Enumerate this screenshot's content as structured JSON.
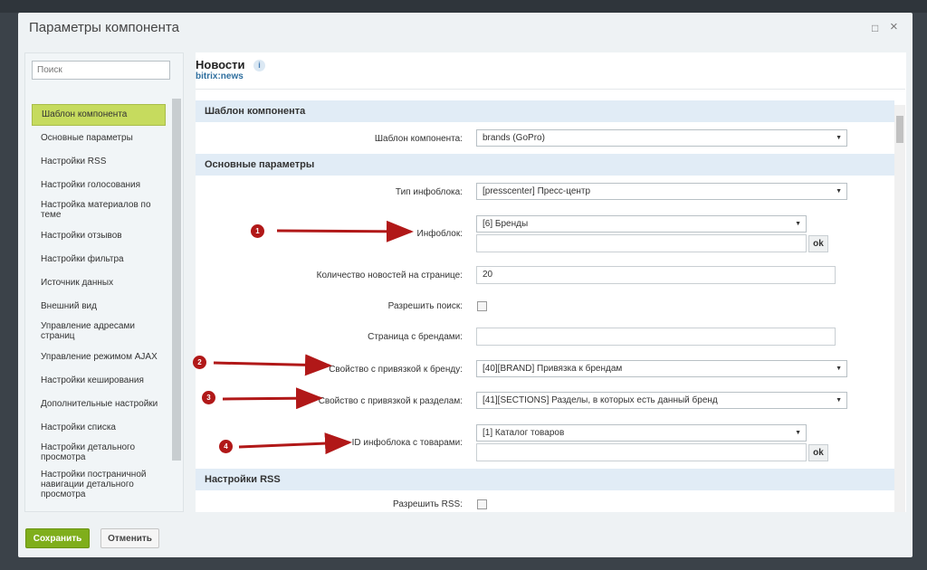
{
  "dialog": {
    "title": "Параметры компонента",
    "collapse": "□",
    "close": "×"
  },
  "sidebar": {
    "search_placeholder": "Поиск",
    "items": [
      "Шаблон компонента",
      "Основные параметры",
      "Настройки RSS",
      "Настройки голосования",
      "Настройка материалов по теме",
      "Настройки отзывов",
      "Настройки фильтра",
      "Источник данных",
      "Внешний вид",
      "Управление адресами страниц",
      "Управление режимом AJAX",
      "Настройки кеширования",
      "Дополнительные настройки",
      "Настройки списка",
      "Настройки детального просмотра",
      "Настройки постраничной навигации детального просмотра"
    ]
  },
  "component": {
    "name": "Новости",
    "code": "bitrix:news",
    "info_icon": "i"
  },
  "sections": {
    "template": "Шаблон компонента",
    "basic": "Основные параметры",
    "rss": "Настройки RSS"
  },
  "fields": {
    "template": {
      "label": "Шаблон компонента:",
      "value": "brands (GoPro)"
    },
    "iblock_type": {
      "label": "Тип инфоблока:",
      "value": "[presscenter] Пресс-центр"
    },
    "iblock": {
      "label": "Инфоблок:",
      "value": "[6] Бренды",
      "input": "",
      "ok": "ok"
    },
    "news_count": {
      "label": "Количество новостей на странице:",
      "value": "20"
    },
    "allow_search": {
      "label": "Разрешить поиск:",
      "checked": false
    },
    "brands_page": {
      "label": "Страница с брендами:",
      "value": ""
    },
    "brand_prop": {
      "label": "Свойство с привязкой к бренду:",
      "value": "[40][BRAND] Привязка к брендам"
    },
    "sections_prop": {
      "label": "Свойство с привязкой к разделам:",
      "value": "[41][SECTIONS] Разделы, в которых есть данный бренд"
    },
    "catalog_iblock": {
      "label": "ID инфоблока с товарами:",
      "value": "[1] Каталог товаров",
      "input": "",
      "ok": "ok"
    },
    "allow_rss": {
      "label": "Разрешить RSS:",
      "checked": false
    }
  },
  "annotations": [
    "1",
    "2",
    "3",
    "4"
  ],
  "footer": {
    "save": "Сохранить",
    "cancel": "Отменить"
  },
  "colors": {
    "accent": "#7fae1b",
    "annotation": "#b11818",
    "active_item": "#c6db5e"
  }
}
